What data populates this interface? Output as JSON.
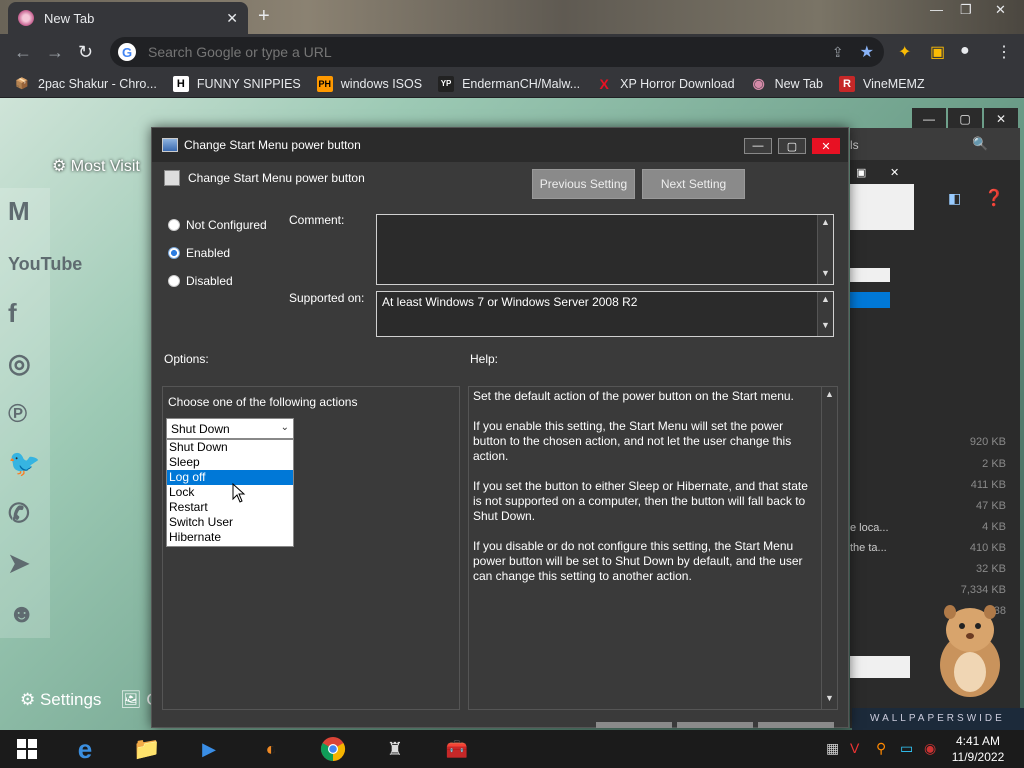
{
  "browser": {
    "tab_title": "New Tab",
    "tab_close": "✕",
    "new_tab": "+",
    "window_controls": [
      "—",
      "❐",
      "✕"
    ],
    "omnibox_placeholder": "Search Google or type a URL",
    "bookmarks": [
      {
        "label": "2pac Shakur - Chro...",
        "icon": "📦"
      },
      {
        "label": "FUNNY SNIPPIES",
        "icon": "H"
      },
      {
        "label": "windows ISOS",
        "icon": "PH"
      },
      {
        "label": "EndermanCH/Malw...",
        "icon": "YP"
      },
      {
        "label": "XP Horror Download",
        "icon": "X"
      },
      {
        "label": "New Tab",
        "icon": "◉"
      },
      {
        "label": "VineMEMZ",
        "icon": "R"
      }
    ]
  },
  "ntp": {
    "most_visited": "Most Visit",
    "settings": "Settings",
    "c_label": "C",
    "social_icons": [
      "gmail-icon",
      "youtube-icon",
      "facebook-icon",
      "instagram-icon",
      "pinterest-icon",
      "twitter-icon",
      "whatsapp-icon",
      "telegram-icon",
      "reddit-icon"
    ],
    "youtube_text": "YouTube"
  },
  "background_window": {
    "fragments": [
      "ls",
      "e loca...",
      "the ta..."
    ],
    "sizes": [
      "920 KB",
      "2 KB",
      "411 KB",
      "47 KB",
      "4 KB",
      "410 KB",
      "32 KB",
      "7,334 KB",
      "38"
    ],
    "wallpaper_text": "WALLPAPERSWIDE"
  },
  "dialog": {
    "title": "Change Start Menu power button",
    "subtitle": "Change Start Menu power button",
    "prev_button": "Previous Setting",
    "next_button": "Next Setting",
    "radios": [
      {
        "label": "Not Configured",
        "checked": false
      },
      {
        "label": "Enabled",
        "checked": true
      },
      {
        "label": "Disabled",
        "checked": false
      }
    ],
    "comment_label": "Comment:",
    "supported_label": "Supported on:",
    "supported_value": "At least Windows 7 or Windows Server 2008 R2",
    "options_label": "Options:",
    "help_label": "Help:",
    "options_prompt": "Choose one of the following actions",
    "select_value": "Shut Down",
    "dropdown_options": [
      "Shut Down",
      "Sleep",
      "Log off",
      "Lock",
      "Restart",
      "Switch User",
      "Hibernate"
    ],
    "dropdown_highlighted": "Log off",
    "help_paragraphs": [
      "Set the default action of the power button on the Start menu.",
      "If you enable this setting, the Start Menu will set the power button to the chosen action, and not let the user change this action.",
      "If you set the button to either Sleep or Hibernate, and that state is not supported on a computer, then the button will fall back to Shut Down.",
      "If you disable or do not configure this setting, the Start Menu power button will be set to Shut Down by default, and the user can change this setting to another action."
    ]
  },
  "taskbar": {
    "time": "4:41 AM",
    "date": "11/9/2022"
  },
  "colors": {
    "accent": "#0078d7",
    "close_red": "#e81123",
    "dialog_bg": "#3a3a3a"
  }
}
